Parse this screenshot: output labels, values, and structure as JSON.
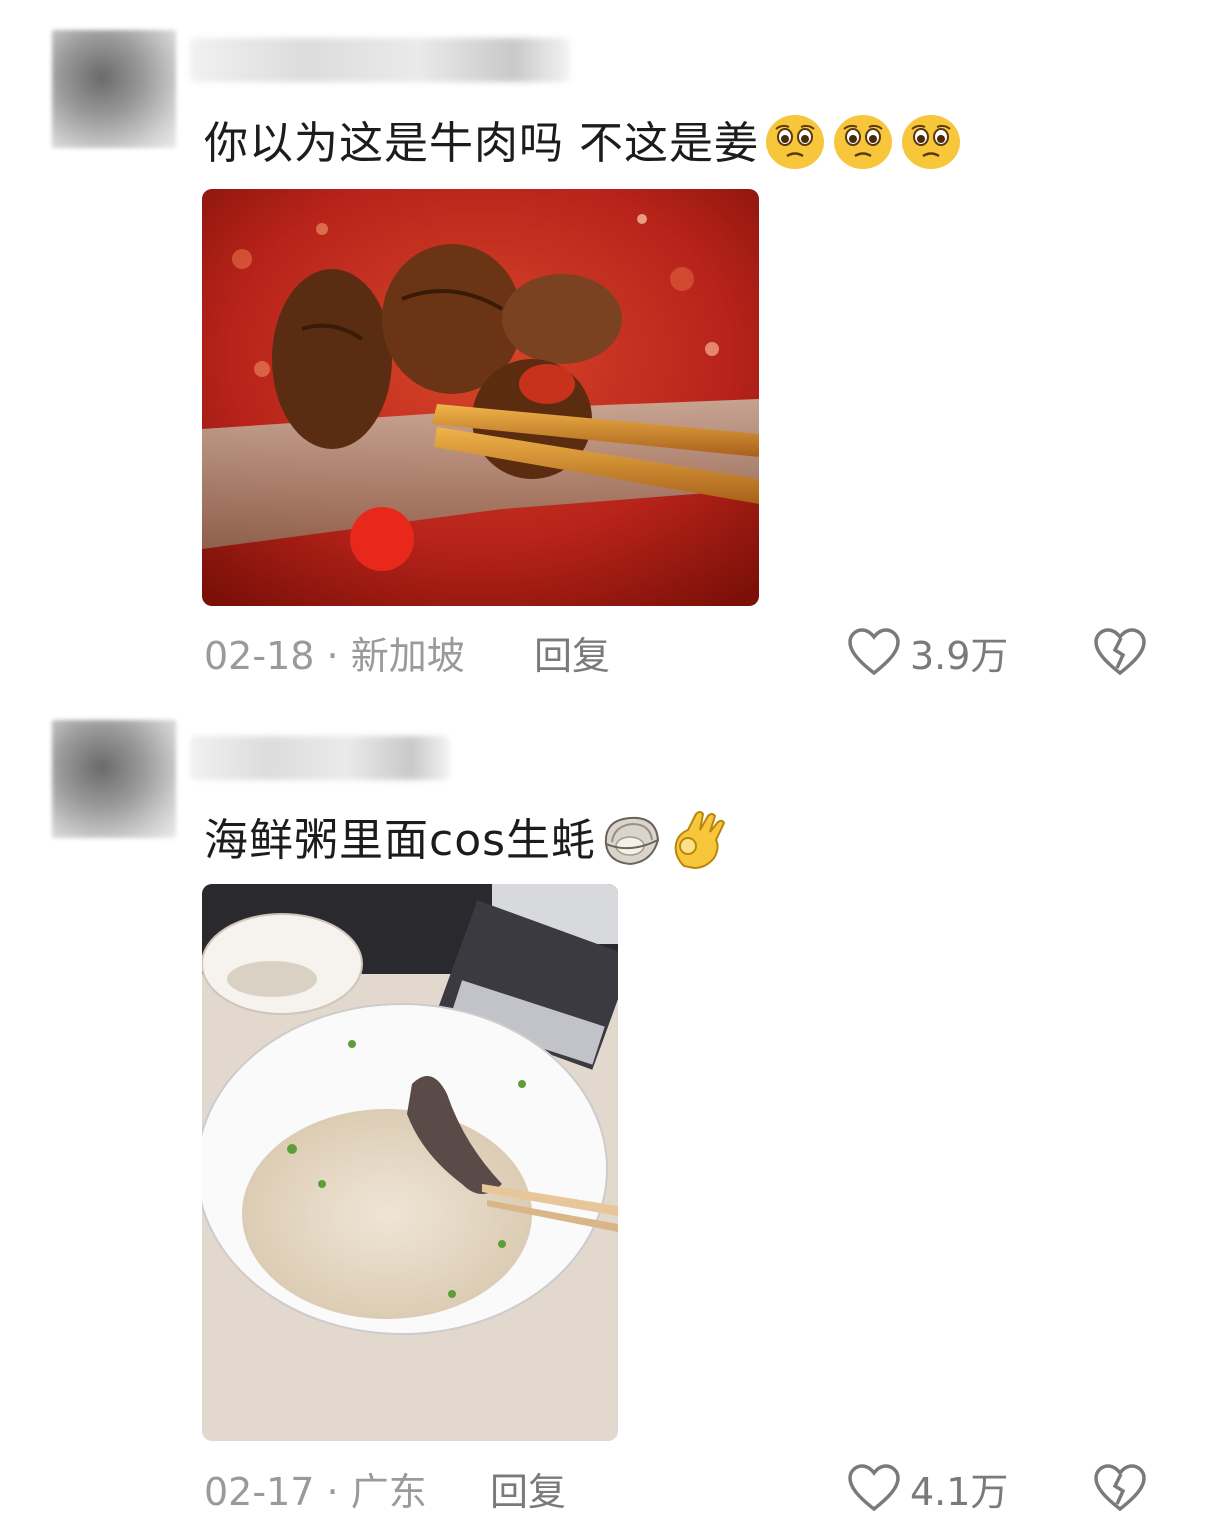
{
  "comments": [
    {
      "text": "你以为这是牛肉吗 不这是姜",
      "emojis": [
        "pleading-face-icon",
        "pleading-face-icon",
        "pleading-face-icon"
      ],
      "date": "02-18",
      "separator": "·",
      "location": "新加坡",
      "reply_label": "回复",
      "like_count": "3.9万"
    },
    {
      "text": "海鲜粥里面cos生蚝",
      "emojis": [
        "oyster-icon",
        "ok-hand-icon"
      ],
      "date": "02-17",
      "separator": "·",
      "location": "广东",
      "reply_label": "回复",
      "like_count": "4.1万"
    }
  ],
  "colors": {
    "text": "#1c1c1c",
    "meta": "#9a9a9a",
    "icon": "#7a7a7a",
    "hotpot_red": "#b8231a",
    "beef_brown": "#5a2d12"
  }
}
